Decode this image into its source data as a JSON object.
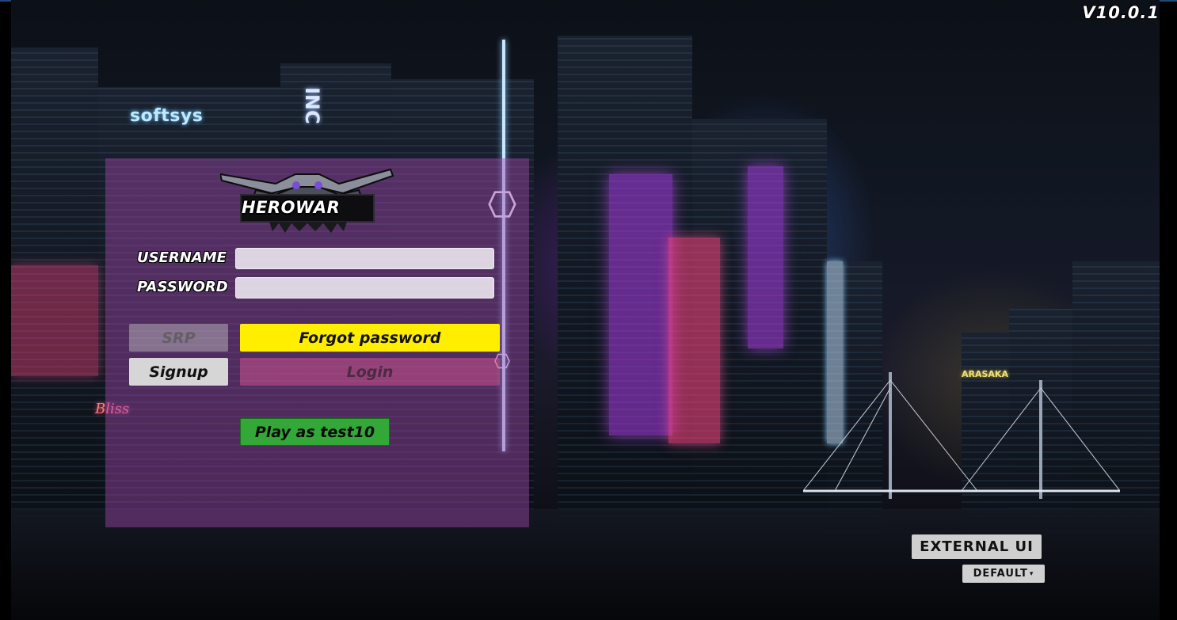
{
  "app": {
    "version": "V10.0.1",
    "logo_text": "HEROWAR"
  },
  "background_signs": {
    "softsys": "softsys",
    "inc": "INC",
    "bliss": "Bliss",
    "arasaka": "ARASAKA"
  },
  "login_form": {
    "username_label": "USERNAME",
    "username_value": "",
    "password_label": "PASSWORD",
    "password_value": "",
    "srp_label": "SRP",
    "forgot_label": "Forgot password",
    "signup_label": "Signup",
    "login_label": "Login",
    "play_label": "Play as test10"
  },
  "ui_switcher": {
    "external_label": "EXTERNAL UI",
    "theme_value": "DEFAULT"
  },
  "colors": {
    "panel": "#a046aa",
    "forgot_button": "#ffee00",
    "play_button": "#33a838",
    "signup_button": "#d6d6d6"
  },
  "icons": [
    "logo-icon",
    "dropdown-caret-icon"
  ]
}
